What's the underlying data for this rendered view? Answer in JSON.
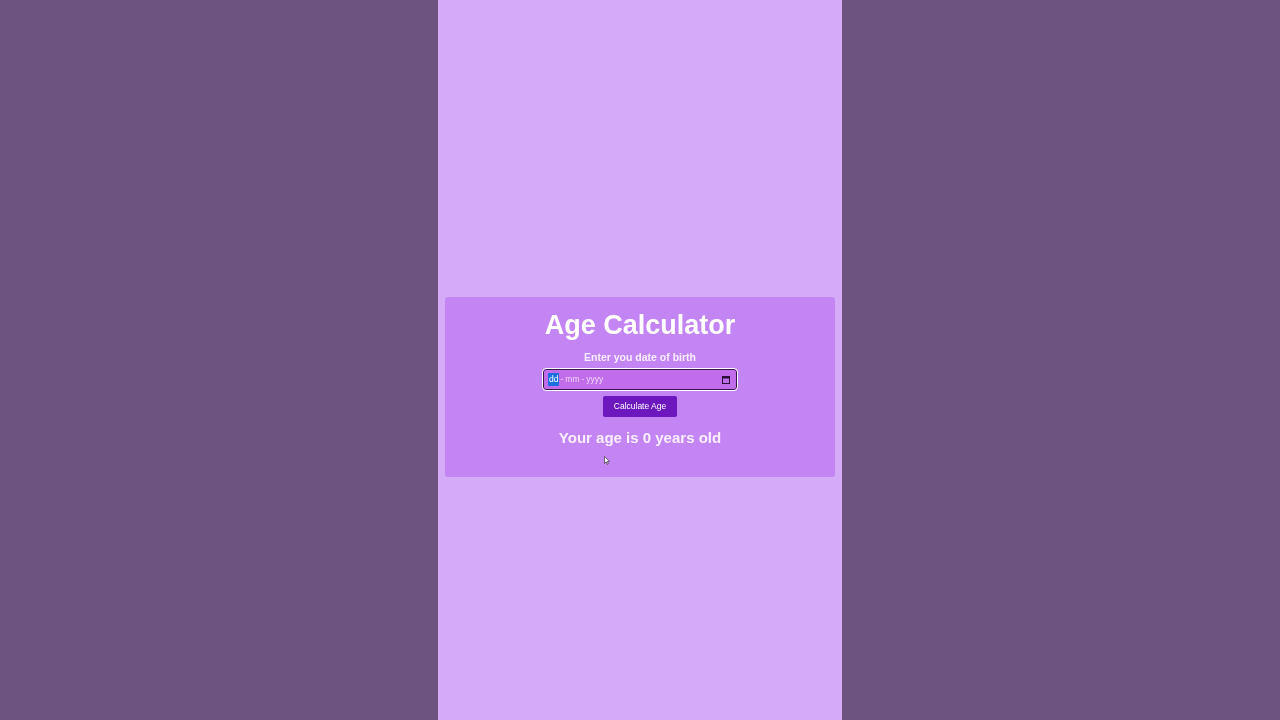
{
  "card": {
    "title": "Age Calculator",
    "label": "Enter you date of birth",
    "date_field": {
      "segments": [
        {
          "kind": "part",
          "text": "dd",
          "selected": true
        },
        {
          "kind": "separator",
          "text": "-"
        },
        {
          "kind": "part",
          "text": "mm",
          "selected": false
        },
        {
          "kind": "separator",
          "text": "-"
        },
        {
          "kind": "part",
          "text": "yyyy",
          "selected": false
        }
      ]
    },
    "button": "Calculate Age",
    "result": "Your age is 0 years old"
  }
}
